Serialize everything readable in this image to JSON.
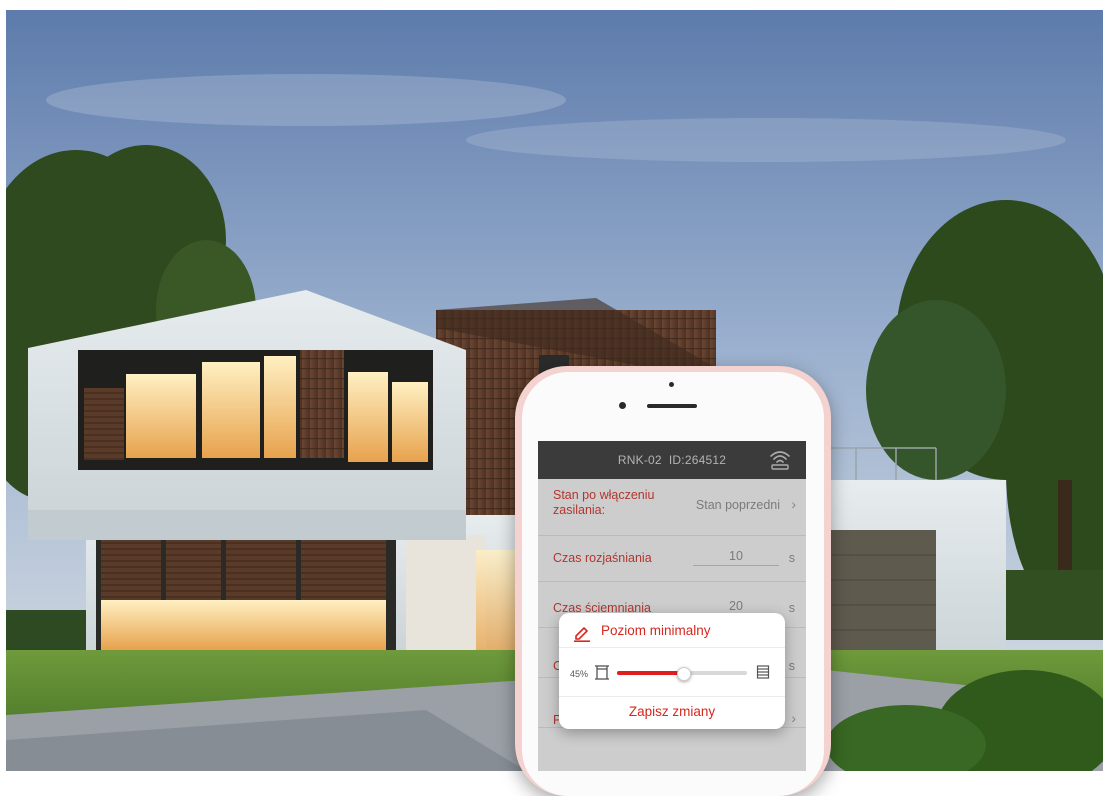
{
  "device": {
    "model": "RNK-02",
    "id": "ID:264512"
  },
  "settings": {
    "power_on_state": {
      "label": "Stan po włączeniu zasilania:",
      "value": "Stan poprzedni"
    },
    "brighten_time": {
      "label": "Czas rozjaśniania",
      "value": "10",
      "unit": "s"
    },
    "dim_time": {
      "label": "Czas ściemniania",
      "value": "20",
      "unit": "s"
    },
    "row4": {
      "label": "C",
      "unit": "s"
    },
    "row5": {
      "label": "P"
    }
  },
  "dialog": {
    "title": "Poziom minimalny",
    "level_label": "45%",
    "level_value": 45,
    "save_label": "Zapisz zmiany"
  },
  "colors": {
    "accent": "#d7271e",
    "slider_fill": "#e01e1e",
    "phone_body": "#f3d2cf",
    "header_bg": "#2f2f2f"
  },
  "icons": [
    "pencil-icon",
    "wifi-signal-icon",
    "blind-open-icon",
    "blind-closed-icon",
    "chevron-right-icon"
  ]
}
